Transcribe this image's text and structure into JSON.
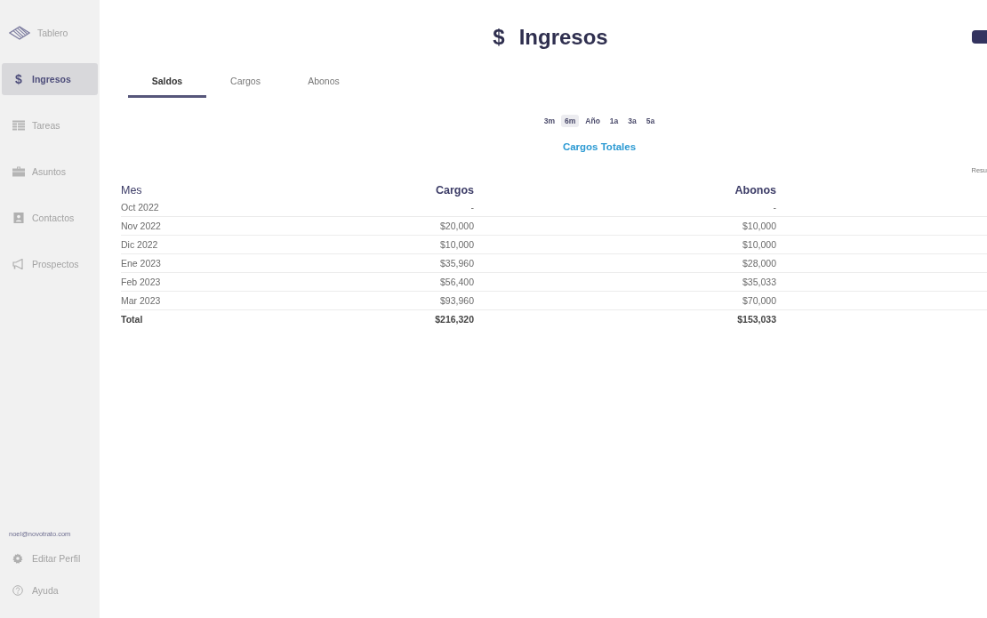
{
  "sidebar": {
    "items": [
      {
        "label": "Tablero",
        "selected": false
      },
      {
        "label": "Ingresos",
        "glyph": "$",
        "selected": true
      },
      {
        "label": "Tareas",
        "selected": false
      },
      {
        "label": "Asuntos",
        "selected": false
      },
      {
        "label": "Contactos",
        "selected": false
      },
      {
        "label": "Prospectos",
        "selected": false
      }
    ],
    "user_email": "noel@novotrato.com",
    "footer_items": [
      {
        "label": "Editar Perfil"
      },
      {
        "label": "Ayuda"
      }
    ]
  },
  "header": {
    "symbol": "$",
    "title": "Ingresos"
  },
  "tabs": [
    {
      "label": "Saldos",
      "selected": true
    },
    {
      "label": "Cargos",
      "selected": false
    },
    {
      "label": "Abonos",
      "selected": false
    }
  ],
  "periods": [
    {
      "label": "3m",
      "selected": false
    },
    {
      "label": "6m",
      "selected": true
    },
    {
      "label": "Año",
      "selected": false
    },
    {
      "label": "1a",
      "selected": false
    },
    {
      "label": "3a",
      "selected": false
    },
    {
      "label": "5a",
      "selected": false
    }
  ],
  "section_title": "Cargos Totales",
  "side_label": "Resu",
  "table": {
    "columns": [
      "Mes",
      "Cargos",
      "Abonos"
    ],
    "rows": [
      [
        "Oct 2022",
        "-",
        "-"
      ],
      [
        "Nov 2022",
        "$20,000",
        "$10,000"
      ],
      [
        "Dic 2022",
        "$10,000",
        "$10,000"
      ],
      [
        "Ene 2023",
        "$35,960",
        "$28,000"
      ],
      [
        "Feb 2023",
        "$56,400",
        "$35,033"
      ],
      [
        "Mar 2023",
        "$93,960",
        "$70,000"
      ]
    ],
    "total": [
      "Total",
      "$216,320",
      "$153,033"
    ]
  }
}
